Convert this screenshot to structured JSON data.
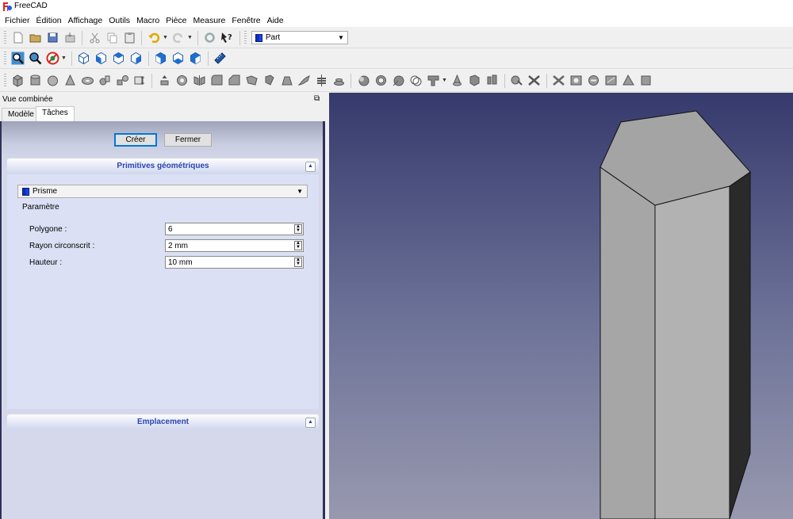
{
  "window": {
    "title": "FreeCAD"
  },
  "menu": [
    "Fichier",
    "Édition",
    "Affichage",
    "Outils",
    "Macro",
    "Pièce",
    "Measure",
    "Fenêtre",
    "Aide"
  ],
  "workbench": {
    "selected": "Part"
  },
  "panel": {
    "title": "Vue combinée",
    "tabs": [
      "Modèle",
      "Tâches"
    ],
    "active_tab": "Tâches",
    "buttons": {
      "create": "Créer",
      "close": "Fermer"
    },
    "primitives": {
      "title": "Primitives géométriques",
      "selected": "Prisme",
      "group_label": "Paramètre",
      "fields": [
        {
          "label": "Polygone :",
          "value": "6"
        },
        {
          "label": "Rayon circonscrit :",
          "value": "2 mm"
        },
        {
          "label": "Hauteur :",
          "value": "10 mm"
        }
      ]
    },
    "placement": {
      "title": "Emplacement"
    }
  },
  "icons": {
    "toolbar1": [
      "new-icon",
      "open-icon",
      "save-icon",
      "save-as-icon",
      "cut-icon",
      "copy-icon",
      "paste-icon",
      "undo-icon",
      "redo-icon",
      "refresh-icon",
      "whats-this-icon"
    ],
    "toolbar2": [
      "fit-all-icon",
      "fit-selection-icon",
      "draw-style-icon",
      "isometric-view-icon",
      "front-view-icon",
      "top-view-icon",
      "right-view-icon",
      "rear-view-icon",
      "bottom-view-icon",
      "left-view-icon",
      "measure-icon"
    ],
    "toolbar3": [
      "box-icon",
      "cylinder-icon",
      "sphere-icon",
      "cone-icon",
      "torus-icon",
      "tube-icon",
      "primitives-icon",
      "shape-builder-icon",
      "extrude-icon",
      "revolve-icon",
      "mirror-icon",
      "fillet-icon",
      "chamfer-icon",
      "make-face-icon",
      "ruled-surface-icon",
      "loft-icon",
      "sweep-icon",
      "section-icon",
      "cross-sections-icon",
      "offset-icon",
      "thickness-icon",
      "projection-icon",
      "boolean-icon",
      "cut-bool-icon",
      "fuse-icon",
      "common-icon",
      "join-features-icon",
      "split-icon",
      "compound-icon",
      "check-geometry-icon",
      "defeaturing-icon",
      "attachment-icon",
      "measure-linear-icon",
      "measure-angular-icon",
      "measure-refresh-icon",
      "measure-clear-icon",
      "measure-toggle-icon",
      "measure-3d-icon"
    ]
  }
}
